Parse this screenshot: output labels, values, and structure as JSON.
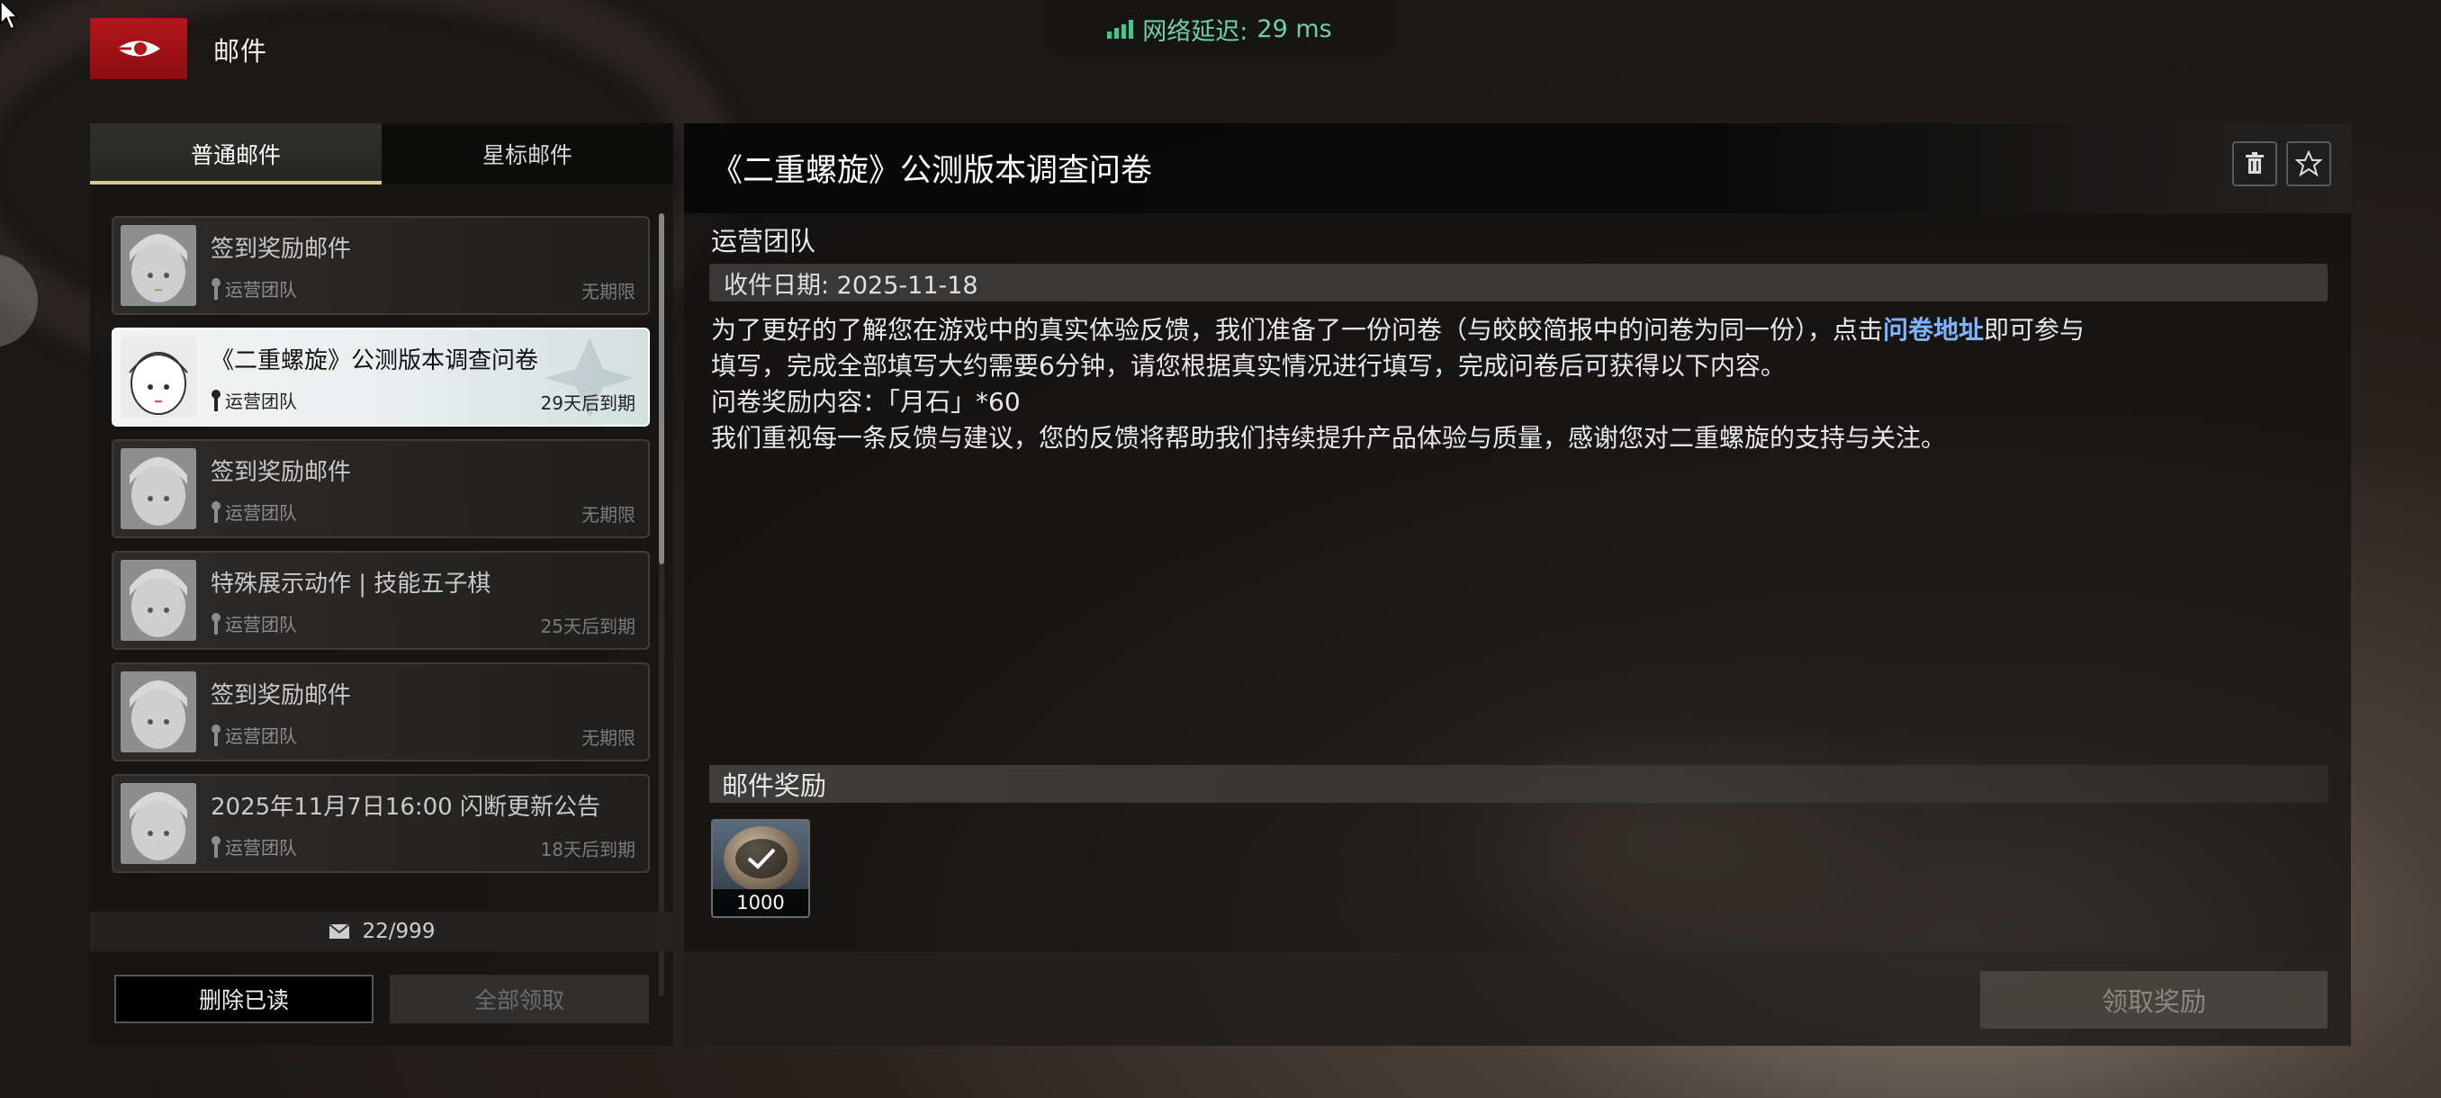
{
  "header": {
    "title": "邮件",
    "latency_label": "网络延迟:",
    "latency_value": "29 ms"
  },
  "tabs": [
    {
      "label": "普通邮件",
      "active": true
    },
    {
      "label": "星标邮件",
      "active": false
    }
  ],
  "mails": [
    {
      "subject": "签到奖励邮件",
      "sender": "运营团队",
      "expiry": "无期限",
      "active": false
    },
    {
      "subject": "《二重螺旋》公测版本调查问卷",
      "sender": "运营团队",
      "expiry": "29天后到期",
      "active": true
    },
    {
      "subject": "签到奖励邮件",
      "sender": "运营团队",
      "expiry": "无期限",
      "active": false
    },
    {
      "subject": "特殊展示动作 | 技能五子棋",
      "sender": "运营团队",
      "expiry": "25天后到期",
      "active": false
    },
    {
      "subject": "签到奖励邮件",
      "sender": "运营团队",
      "expiry": "无期限",
      "active": false
    },
    {
      "subject": "2025年11月7日16:00 闪断更新公告",
      "sender": "运营团队",
      "expiry": "18天后到期",
      "active": false
    }
  ],
  "mail_count": "22/999",
  "buttons": {
    "delete_read": "删除已读",
    "claim_all": "全部领取",
    "claim_reward": "领取奖励"
  },
  "detail": {
    "title": "《二重螺旋》公测版本调查问卷",
    "sender": "运营团队",
    "date": "收件日期: 2025-11-18",
    "body_line1_pre": "为了更好的了解您在游戏中的真实体验反馈，我们准备了一份问卷（与皎皎简报中的问卷为同一份），点击",
    "body_link": "问卷地址",
    "body_line1_post": "即可参与",
    "body_line2": "填写，完成全部填写大约需要6分钟，请您根据真实情况进行填写，完成问卷后可获得以下内容。",
    "body_line3": "问卷奖励内容：「月石」*60",
    "body_line4": "我们重视每一条反馈与建议，您的反馈将帮助我们持续提升产品体验与质量，感谢您对二重螺旋的支持与关注。",
    "rewards_title": "邮件奖励",
    "reward_qty": "1000"
  },
  "colors": {
    "accent": "#d9c98d",
    "brand_red": "#b3161b",
    "link": "#7fb4ff",
    "latency": "#6fd0a6"
  },
  "icons": [
    "mouse-cursor-icon",
    "logo-icon",
    "signal-icon",
    "mail-icon",
    "trash-icon",
    "star-icon",
    "check-icon",
    "pin-icon"
  ]
}
